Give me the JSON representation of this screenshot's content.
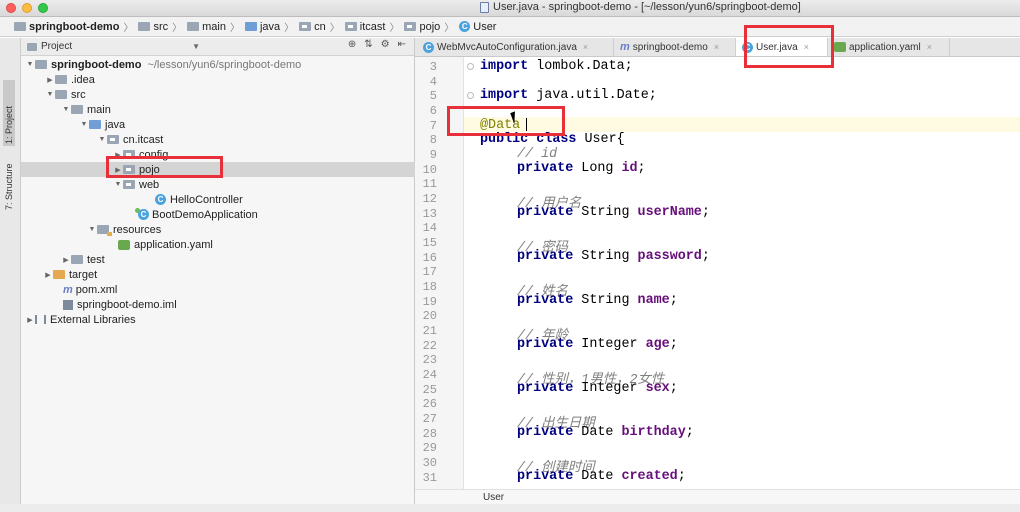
{
  "window": {
    "title": "User.java - springboot-demo - [~/lesson/yun6/springboot-demo]"
  },
  "breadcrumbs": [
    "springboot-demo",
    "src",
    "main",
    "java",
    "cn",
    "itcast",
    "pojo",
    "User"
  ],
  "left_strip": {
    "project_tab": "1: Project",
    "structure_tab": "7: Structure"
  },
  "project_panel": {
    "header": "Project",
    "tree": [
      {
        "label": "springboot-demo",
        "path": "~/lesson/yun6/springboot-demo"
      },
      {
        "label": ".idea"
      },
      {
        "label": "src"
      },
      {
        "label": "main"
      },
      {
        "label": "java"
      },
      {
        "label": "cn.itcast"
      },
      {
        "label": "config"
      },
      {
        "label": "pojo"
      },
      {
        "label": "web"
      },
      {
        "label": "HelloController"
      },
      {
        "label": "BootDemoApplication"
      },
      {
        "label": "resources"
      },
      {
        "label": "application.yaml"
      },
      {
        "label": "test"
      },
      {
        "label": "target"
      },
      {
        "label": "pom.xml"
      },
      {
        "label": "springboot-demo.iml"
      },
      {
        "label": "External Libraries"
      }
    ]
  },
  "tabs": [
    {
      "label": "WebMvcAutoConfiguration.java"
    },
    {
      "label": "springboot-demo"
    },
    {
      "label": "User.java"
    },
    {
      "label": "application.yaml"
    }
  ],
  "editor": {
    "line_numbers": [
      "3",
      "4",
      "5",
      "6",
      "7",
      "8",
      "9",
      "10",
      "11",
      "12",
      "13",
      "14",
      "15",
      "16",
      "17",
      "18",
      "19",
      "20",
      "21",
      "22",
      "23",
      "24",
      "25",
      "26",
      "27",
      "28",
      "29",
      "30",
      "31"
    ],
    "code": {
      "import1_kw": "import",
      "import1_rest": " lombok.Data;",
      "import2_kw": "import",
      "import2_rest": " java.util.Date;",
      "annotation": "@Data",
      "class_kw": "public class",
      "class_rest": " User{",
      "c_id": "// id",
      "f_id_kw": "private",
      "f_id_type": " Long ",
      "f_id_name": "id",
      "c_username": "// 用户名",
      "f_username_type": " String ",
      "f_username_name": "userName",
      "c_password": "// 密码",
      "f_password_type": " String ",
      "f_password_name": "password",
      "c_name": "// 姓名",
      "f_name_type": " String ",
      "f_name_name": "name",
      "c_age": "// 年龄",
      "f_age_type": " Integer ",
      "f_age_name": "age",
      "c_sex": "// 性别，1男性，2女性",
      "f_sex_type": " Integer ",
      "f_sex_name": "sex",
      "c_birthday": "// 出生日期",
      "f_birthday_type": " Date ",
      "f_birthday_name": "birthday",
      "c_created": "// 创建时间",
      "f_created_type": " Date ",
      "f_created_name": "created",
      "semicolon": ";"
    },
    "footer_crumb": "User"
  },
  "highlight_color": "#e8303a"
}
